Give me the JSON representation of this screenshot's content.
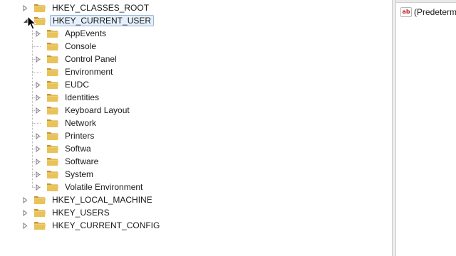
{
  "tree": {
    "roots_top": [
      {
        "label": "HKEY_CLASSES_ROOT",
        "expanded": false,
        "selected": false
      },
      {
        "label": "HKEY_CURRENT_USER",
        "expanded": true,
        "selected": true
      }
    ],
    "children": [
      {
        "label": "AppEvents",
        "has_children": true
      },
      {
        "label": "Console",
        "has_children": false
      },
      {
        "label": "Control Panel",
        "has_children": true
      },
      {
        "label": "Environment",
        "has_children": false
      },
      {
        "label": "EUDC",
        "has_children": true
      },
      {
        "label": "Identities",
        "has_children": true
      },
      {
        "label": "Keyboard Layout",
        "has_children": true
      },
      {
        "label": "Network",
        "has_children": false
      },
      {
        "label": "Printers",
        "has_children": true
      },
      {
        "label": "Softwa",
        "has_children": true
      },
      {
        "label": "Software",
        "has_children": true
      },
      {
        "label": "System",
        "has_children": true
      },
      {
        "label": "Volatile Environment",
        "has_children": true
      }
    ],
    "roots_bottom": [
      {
        "label": "HKEY_LOCAL_MACHINE",
        "expanded": false
      },
      {
        "label": "HKEY_USERS",
        "expanded": false
      },
      {
        "label": "HKEY_CURRENT_CONFIG",
        "expanded": false
      }
    ]
  },
  "values": {
    "items": [
      {
        "icon": "string-value-icon",
        "icon_text": "ab",
        "name": "(Predetermi"
      }
    ]
  },
  "colors": {
    "folder": "#e8c35a",
    "folder_dark": "#c9962a",
    "selection_bg": "#e6f0fa",
    "selection_border": "#8fb6dd",
    "icon_ab": "#c02020"
  }
}
